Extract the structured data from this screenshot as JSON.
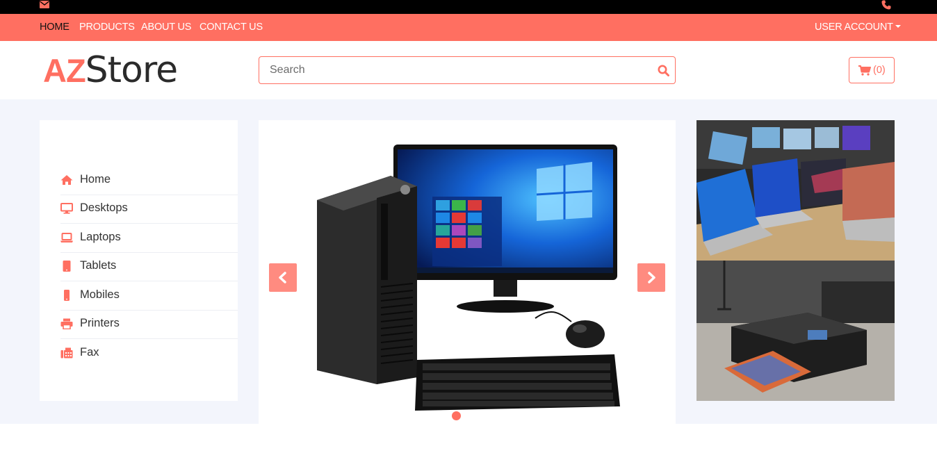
{
  "topbar": {
    "mail_icon": "envelope-icon",
    "phone_icon": "phone-icon"
  },
  "nav": {
    "items": [
      {
        "label": "HOME",
        "active": true
      },
      {
        "label": "PRODUCTS",
        "active": false
      },
      {
        "label": "ABOUT US",
        "active": false
      },
      {
        "label": "CONTACT US",
        "active": false
      }
    ],
    "account_label": "USER ACCOUNT"
  },
  "header": {
    "logo": {
      "part1": "AZ",
      "part2": "Store"
    },
    "search": {
      "placeholder": "Search",
      "value": "",
      "icon": "search-icon"
    },
    "cart": {
      "icon": "shopping-cart-icon",
      "count_label": "(0)"
    }
  },
  "sidebar": {
    "items": [
      {
        "label": "Home",
        "icon": "home-icon"
      },
      {
        "label": "Desktops",
        "icon": "desktop-icon"
      },
      {
        "label": "Laptops",
        "icon": "laptop-icon"
      },
      {
        "label": "Tablets",
        "icon": "tablet-icon"
      },
      {
        "label": "Mobiles",
        "icon": "mobile-icon"
      },
      {
        "label": "Printers",
        "icon": "printer-icon"
      },
      {
        "label": "Fax",
        "icon": "fax-icon"
      }
    ]
  },
  "carousel": {
    "slide_image": "desktop-computer-image",
    "prev_icon": "chevron-left-icon",
    "next_icon": "chevron-right-icon",
    "active_slide": 1
  },
  "promos": [
    {
      "image": "laptops-display-image"
    },
    {
      "image": "photo-printer-image"
    }
  ],
  "colors": {
    "accent": "#ff6f61",
    "topbar": "#000000",
    "background": "#f3f5fc"
  }
}
